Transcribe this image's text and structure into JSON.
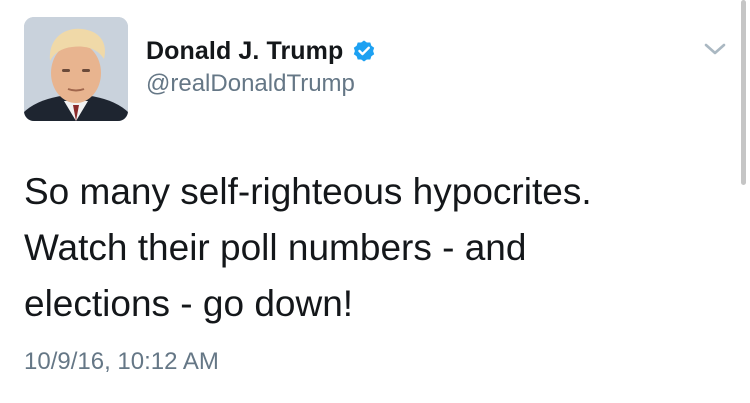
{
  "author": {
    "display_name": "Donald J. Trump",
    "handle": "@realDonaldTrump",
    "verified": true,
    "avatar_icon": "profile-photo"
  },
  "tweet": {
    "lines": [
      "So many self-righteous hypocrites.",
      "Watch their poll numbers - and",
      "elections - go down!"
    ],
    "timestamp": "10/9/16, 10:12 AM"
  },
  "icons": {
    "verified": "verified-badge-icon",
    "menu": "chevron-down-icon"
  },
  "colors": {
    "verified_blue": "#1da1f2",
    "text": "#14171a",
    "secondary_text": "#657786"
  }
}
